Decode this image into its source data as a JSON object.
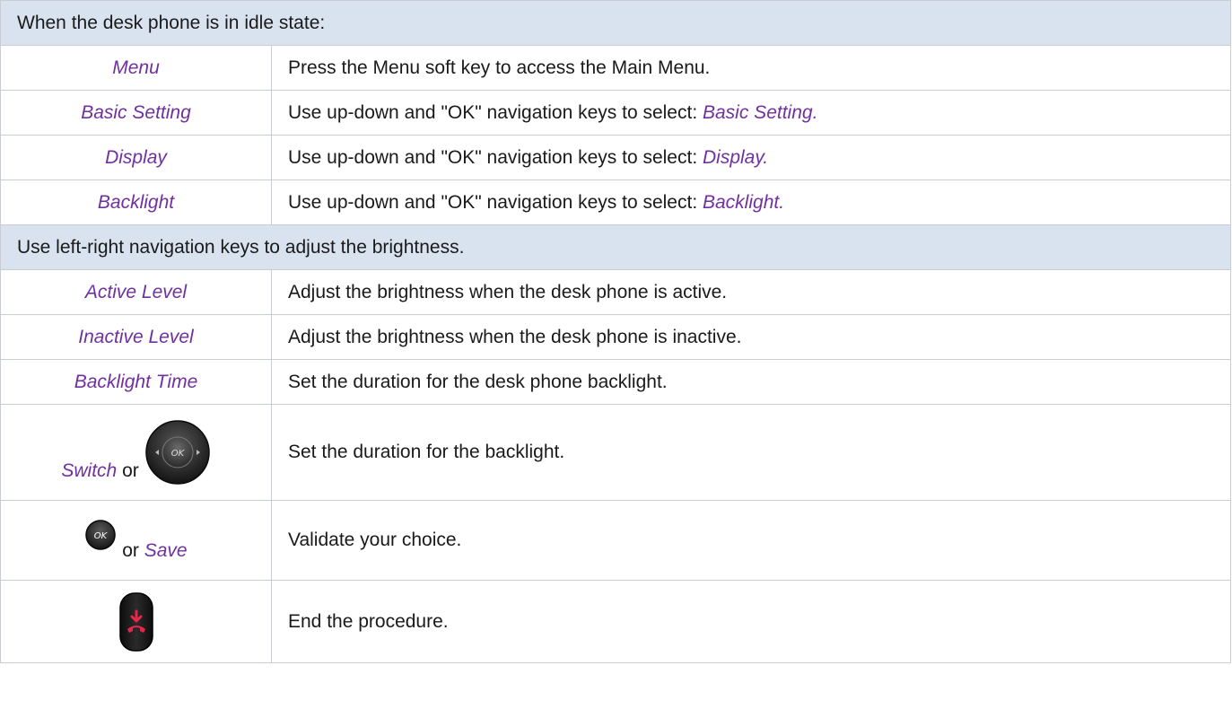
{
  "sections": {
    "idle_header": "When the desk phone is in idle state:",
    "brightness_header": "Use left-right navigation keys to adjust the brightness."
  },
  "steps": [
    {
      "key": "Menu",
      "description": "Press the Menu soft key to access the Main Menu."
    },
    {
      "key": "Basic Setting",
      "description_prefix": "Use up-down and \"OK\" navigation keys to select: ",
      "description_emphasis": "Basic Setting."
    },
    {
      "key": "Display",
      "description_prefix": "Use up-down and \"OK\" navigation keys to select: ",
      "description_emphasis": "Display."
    },
    {
      "key": "Backlight",
      "description_prefix": "Use up-down and \"OK\" navigation keys to select: ",
      "description_emphasis": "Backlight."
    }
  ],
  "settings": [
    {
      "key": "Active Level",
      "description": "Adjust the brightness when the desk phone is active."
    },
    {
      "key": "Inactive Level",
      "description": "Adjust the brightness when the desk phone is inactive."
    },
    {
      "key": "Backlight Time",
      "description": "Set the duration for the desk phone backlight."
    },
    {
      "key": "Switch",
      "connector": "or",
      "icon": "navigation-wheel-icon",
      "icon_label": "OK",
      "description": "Set the duration for the backlight."
    },
    {
      "key": "Save",
      "connector": "or",
      "icon": "ok-key-icon",
      "icon_label": "OK",
      "description": "Validate your choice."
    },
    {
      "icon": "hang-up-key-icon",
      "description": "End the procedure."
    }
  ],
  "colors": {
    "key_text": "#7030a0",
    "header_background": "#d9e3f0",
    "border": "#c9ccd3",
    "hang_up_red": "#e8254a"
  }
}
